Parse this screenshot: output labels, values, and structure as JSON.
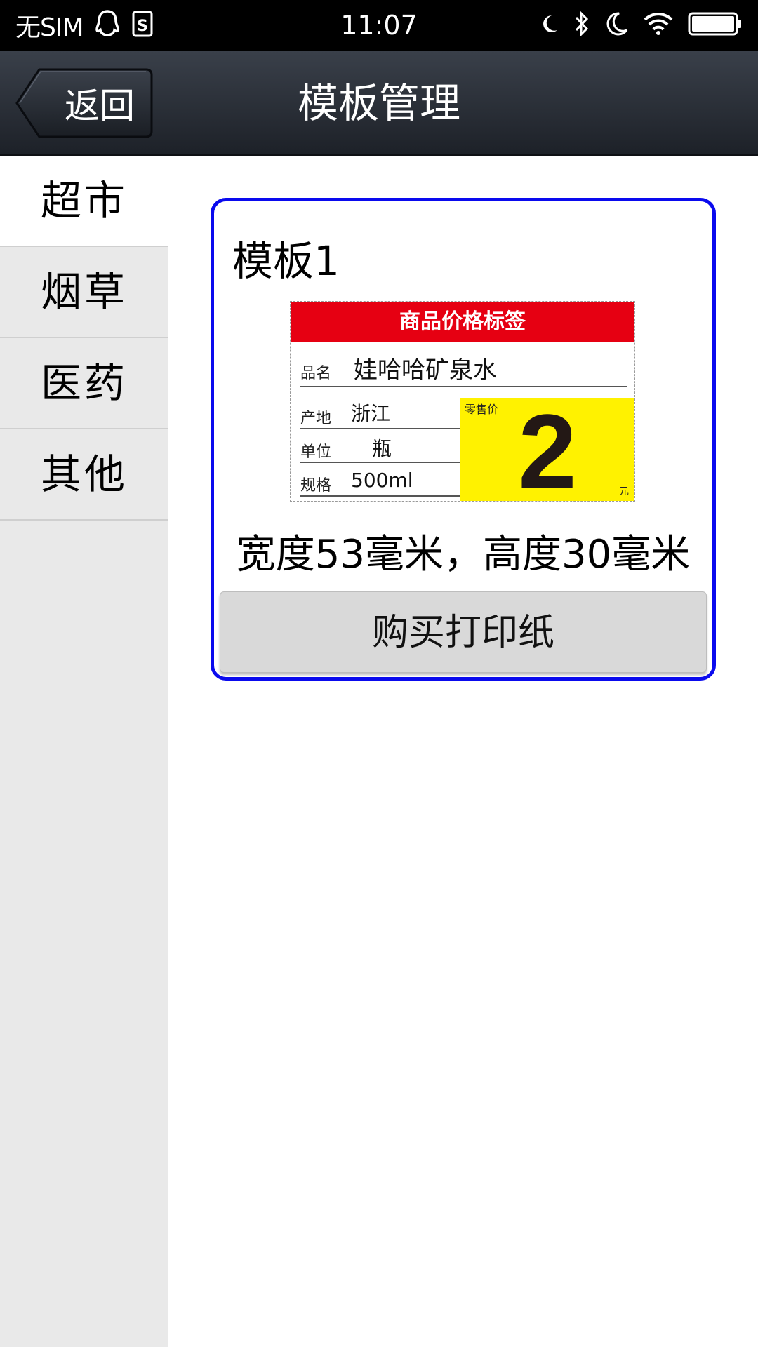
{
  "status_bar": {
    "carrier": "无SIM",
    "time": "11:07",
    "icons": [
      "qq-icon",
      "sim-card-icon",
      "moon-icon",
      "bluetooth-icon",
      "do-not-disturb-icon",
      "wifi-icon",
      "battery-icon"
    ]
  },
  "nav": {
    "back_label": "返回",
    "title": "模板管理"
  },
  "sidebar": {
    "items": [
      {
        "label": "超市",
        "active": true
      },
      {
        "label": "烟草",
        "active": false
      },
      {
        "label": "医药",
        "active": false
      },
      {
        "label": "其他",
        "active": false
      }
    ]
  },
  "template": {
    "title": "模板1",
    "preview": {
      "header": "商品价格标签",
      "name_key": "品名",
      "name_value": "娃哈哈矿泉水",
      "origin_key": "产地",
      "origin_value": "浙江",
      "unit_key": "单位",
      "unit_value": "瓶",
      "spec_key": "规格",
      "spec_value": "500ml",
      "price_tag": "零售价",
      "price_value": "2",
      "price_unit": "元"
    },
    "dimensions": "宽度53毫米，高度30毫米",
    "buy_label": "购买打印纸"
  },
  "colors": {
    "card_border": "#0a0aee",
    "label_header": "#e60012",
    "price_box": "#fff200"
  }
}
